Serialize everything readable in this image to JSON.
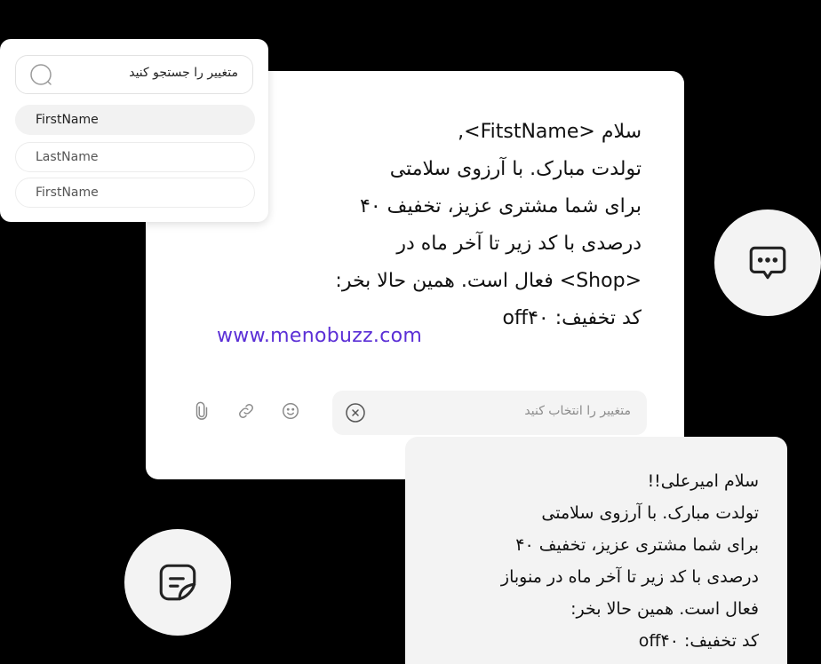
{
  "editor": {
    "message_lines": [
      "سلام <FitstName>,",
      "تولدت مبارک. با آرزوی سلامتی",
      "برای شما مشتری عزیز، تخفیف ۴۰",
      "درصدی با کد زیر تا آخر ماه در",
      "<Shop> فعال است. همین حالا بخر:",
      "کد تخفیف: off۴۰"
    ],
    "link_text": "www.menobuzz.com",
    "variable_select_placeholder": "متغییر را انتخاب کنید",
    "toolbar_icons": [
      "paperclip-icon",
      "link-icon",
      "emoji-icon"
    ],
    "clear_icon": "close-circle-icon"
  },
  "dropdown": {
    "search_placeholder": "متغییر را جستجو کنید",
    "search_icon": "search-icon",
    "options": [
      "FirstName",
      "LastName",
      "FirstName"
    ],
    "selected_index": 0
  },
  "chat_icon": "chat-bubble-dots-icon",
  "note_icon": "sticky-note-icon",
  "preview": {
    "lines": [
      "سلام امیرعلی!!",
      "تولدت مبارک. با آرزوی سلامتی",
      "برای شما مشتری عزیز، تخفیف ۴۰",
      "درصدی با کد زیر تا آخر ماه در منوباز",
      "فعال است. همین حالا بخر:",
      "کد تخفیف: off۴۰"
    ]
  },
  "colors": {
    "background": "#000000",
    "link": "#5b2fd6",
    "card": "#ffffff",
    "preview_card": "#f3f3f3"
  }
}
